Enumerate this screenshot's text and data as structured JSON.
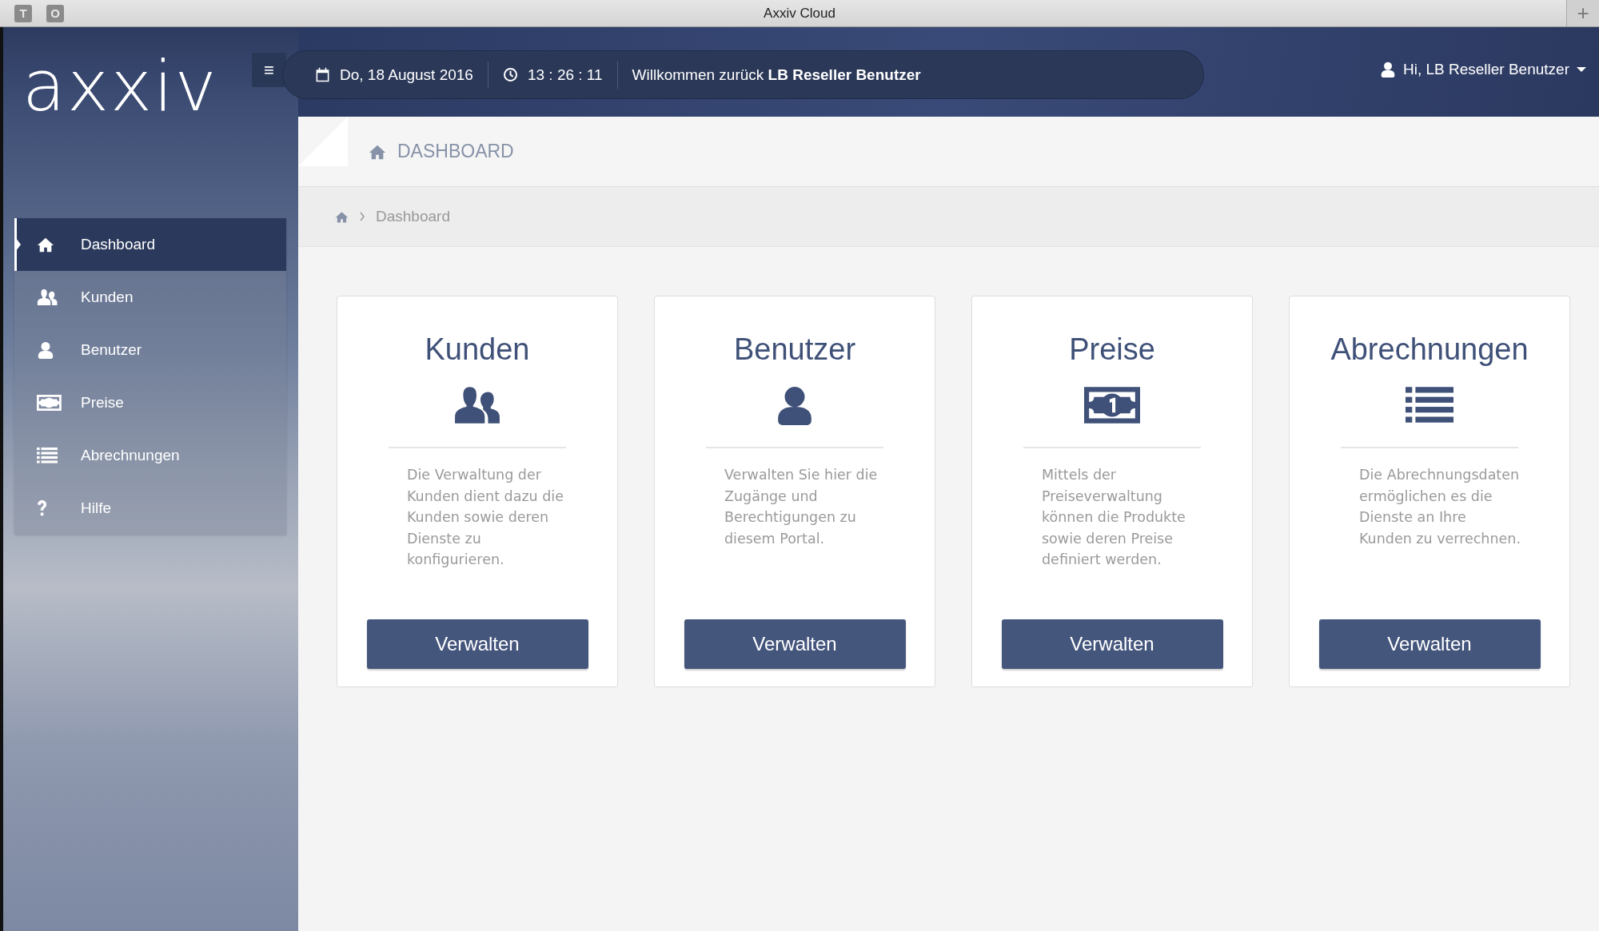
{
  "window": {
    "title": "Axxiv Cloud",
    "left_buttons": [
      "T",
      "O"
    ],
    "new_tab": "+"
  },
  "logo": "axxiv",
  "menu_toggle": "≡",
  "infobar": {
    "date": "Do, 18 August 2016",
    "time": "13 : 26 : 11",
    "welcome": "Willkommen zurück **LB Reseller Benutzer**"
  },
  "user_menu": {
    "label": "Hi, LB Reseller Benutzer"
  },
  "sidebar": {
    "items": [
      {
        "label": "Dashboard",
        "selected": true
      },
      {
        "label": "Kunden",
        "selected": false
      },
      {
        "label": "Benutzer",
        "selected": false
      },
      {
        "label": "Preise",
        "selected": false
      },
      {
        "label": "Abrechnungen",
        "selected": false
      },
      {
        "label": "Hilfe",
        "selected": false
      }
    ]
  },
  "page_title": "DASHBOARD",
  "breadcrumb": [
    "Dashboard"
  ],
  "cards": [
    {
      "title": "Kunden",
      "description": "Die Verwaltung der Kunden dient dazu die Kunden sowie deren Dienste zu konfigurieren.",
      "button": "Verwalten"
    },
    {
      "title": "Benutzer",
      "description": "Verwalten Sie hier die Zugänge und Berechtigungen zu diesem Portal.",
      "button": "Verwalten"
    },
    {
      "title": "Preise",
      "description": "Mittels der Preiseverwaltung können die Produkte sowie deren Preise definiert werden.",
      "button": "Verwalten"
    },
    {
      "title": "Abrechnungen",
      "description": "Die Abrechnungsdaten ermöglichen es die Dienste an Ihre Kunden zu verrechnen.",
      "button": "Verwalten"
    }
  ]
}
